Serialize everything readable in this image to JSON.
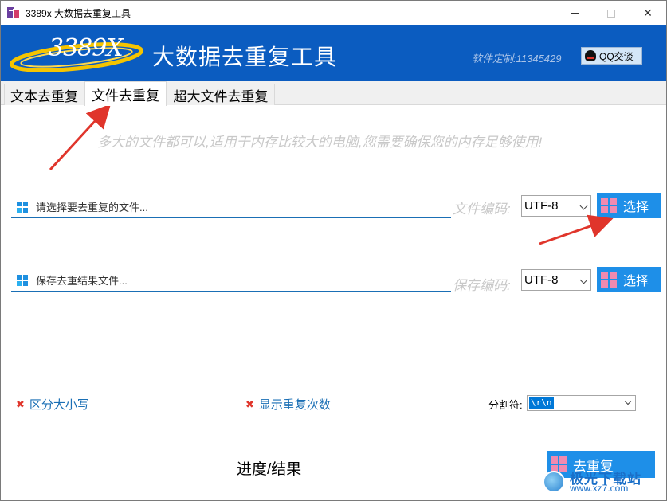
{
  "window": {
    "title": "3389x 大数据去重复工具",
    "controls": [
      "minimize",
      "maximize",
      "close"
    ]
  },
  "banner": {
    "logo_text": "3389X",
    "title": "大数据去重复工具",
    "custom_text": "软件定制:11345429",
    "qq_button": "QQ交谈"
  },
  "tabs": [
    {
      "label": "文本去重复",
      "active": false
    },
    {
      "label": "文件去重复",
      "active": true
    },
    {
      "label": "超大文件去重复",
      "active": false
    }
  ],
  "hint": "多大的文件都可以,适用于内存比较大的电脑,您需要确保您的内存足够使用!",
  "input_file": {
    "placeholder": "请选择要去重复的文件...",
    "encoding_label": "文件编码:",
    "encoding_value": "UTF-8",
    "select_button": "选择"
  },
  "output_file": {
    "placeholder": "保存去重结果文件...",
    "encoding_label": "保存编码:",
    "encoding_value": "UTF-8",
    "select_button": "选择"
  },
  "options": {
    "case_sensitive": {
      "label": "区分大小写",
      "checked": false
    },
    "show_count": {
      "label": "显示重复次数",
      "checked": false
    },
    "separator_label": "分割符:",
    "separator_value": "\\r\\n"
  },
  "progress_label": "进度/结果",
  "dedupe_button": "去重复",
  "watermark": {
    "text": "极光下载站",
    "url": "www.xz7.com"
  },
  "colors": {
    "banner": "#0b5cc0",
    "button": "#1e8fe8",
    "arrow": "#e0352b",
    "hint": "#c8c8c8"
  }
}
